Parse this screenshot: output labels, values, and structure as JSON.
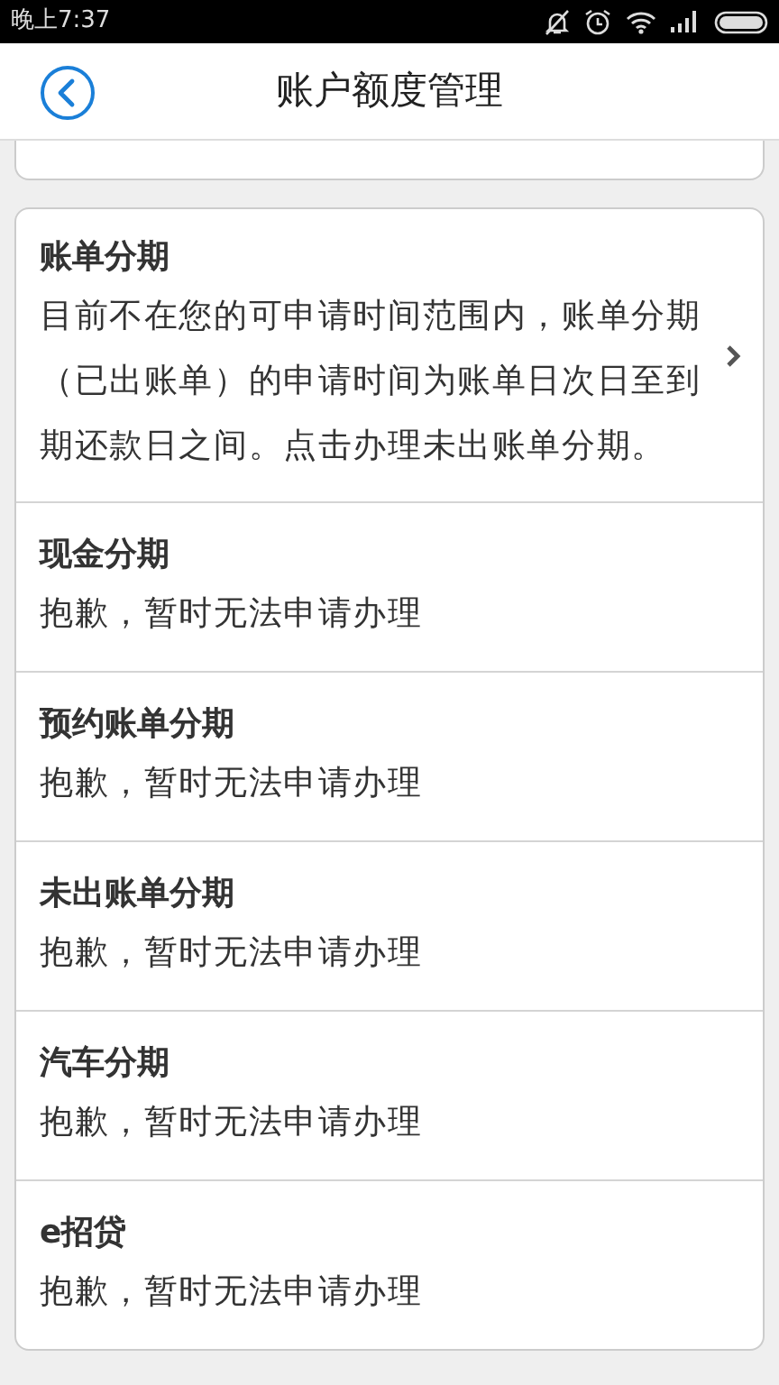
{
  "status_bar": {
    "time": "晚上7:37"
  },
  "header": {
    "title": "账户额度管理"
  },
  "items": [
    {
      "title": "账单分期",
      "text": "目前不在您的可申请时间范围内，账单分期（已出账单）的申请时间为账单日次日至到期还款日之间。点击办理未出账单分期。",
      "has_arrow": true
    },
    {
      "title": "现金分期",
      "text": "抱歉，暂时无法申请办理",
      "has_arrow": false
    },
    {
      "title": "预约账单分期",
      "text": "抱歉，暂时无法申请办理",
      "has_arrow": false
    },
    {
      "title": "未出账单分期",
      "text": "抱歉，暂时无法申请办理",
      "has_arrow": false
    },
    {
      "title": "汽车分期",
      "text": "抱歉，暂时无法申请办理",
      "has_arrow": false
    },
    {
      "title": "e招贷",
      "text": "抱歉，暂时无法申请办理",
      "has_arrow": false
    }
  ]
}
